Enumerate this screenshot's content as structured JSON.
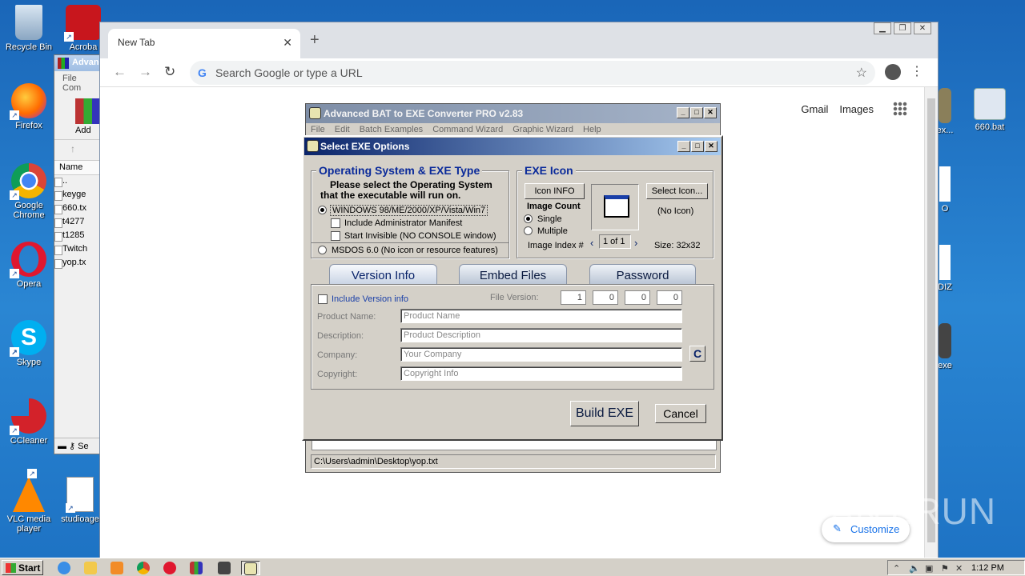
{
  "desktop": {
    "icons": [
      {
        "label": "Recycle Bin"
      },
      {
        "label": "Acroba"
      },
      {
        "label": "Firefox"
      },
      {
        "label": "Google Chrome"
      },
      {
        "label": "Opera"
      },
      {
        "label": "Skype"
      },
      {
        "label": "CCleaner"
      },
      {
        "label": "VLC media player"
      },
      {
        "label": "studioage"
      },
      {
        "label": "ex..."
      },
      {
        "label": "660.bat"
      },
      {
        "label": "O"
      },
      {
        "label": "DIZ"
      },
      {
        "label": "exe"
      }
    ]
  },
  "winrar": {
    "title": "Advan",
    "menu": [
      "File",
      "Com"
    ],
    "add_label": "Add",
    "column_name": "Name",
    "files": [
      "..",
      "keyge",
      "660.tx",
      "t4277",
      "t1285",
      "Twitch",
      "yop.tx"
    ],
    "status_icon": "Se"
  },
  "browser": {
    "tab_title": "New Tab",
    "omnibox_placeholder": "Search Google or type a URL",
    "links": {
      "gmail": "Gmail",
      "images": "Images"
    },
    "customize": "Customize"
  },
  "bat_window": {
    "title": "Advanced BAT to EXE Converter PRO v2.83",
    "menu": [
      "File",
      "Edit",
      "Batch Examples",
      "Command Wizard",
      "Graphic Wizard",
      "Help"
    ],
    "status_path": "C:\\Users\\admin\\Desktop\\yop.txt"
  },
  "dialog": {
    "title": "Select EXE Options",
    "os_group": {
      "legend": "Operating System & EXE Type",
      "instructions_line1": "Please select the Operating System",
      "instructions_line2": "that the executable will run on.",
      "windows_option": "WINDOWS   98/ME/2000/XP/Vista/Win7",
      "admin_manifest": "Include Administrator Manifest",
      "start_invisible": "Start Invisible   (NO CONSOLE window)",
      "msdos_option": "MSDOS 6.0   (No icon or resource features)",
      "selected": "WINDOWS"
    },
    "icon_group": {
      "legend": "EXE Icon",
      "icon_info": "Icon INFO",
      "select_icon": "Select Icon...",
      "image_count": "Image Count",
      "single": "Single",
      "multiple": "Multiple",
      "no_icon": "(No Icon)",
      "image_index_label": "Image Index #",
      "image_index_value": "1 of 1",
      "size": "Size: 32x32",
      "selected_count": "Single"
    },
    "tabs": [
      {
        "label": "Version Info"
      },
      {
        "label": "Embed Files"
      },
      {
        "label": "Password"
      }
    ],
    "active_tab": "Version Info",
    "version": {
      "include_label": "Include Version info",
      "file_version_label": "File Version:",
      "file_version": [
        "1",
        "0",
        "0",
        "0"
      ],
      "product_name_label": "Product Name:",
      "product_name": "Product Name",
      "description_label": "Description:",
      "description": "Product Description",
      "company_label": "Company:",
      "company": "Your Company",
      "copyright_label": "Copyright:",
      "copyright": "Copyright Info",
      "c_button": "C"
    },
    "build_button": "Build EXE",
    "cancel_button": "Cancel"
  },
  "taskbar": {
    "start": "Start",
    "clock": "1:12 PM"
  },
  "watermark": "ANY.RUN"
}
